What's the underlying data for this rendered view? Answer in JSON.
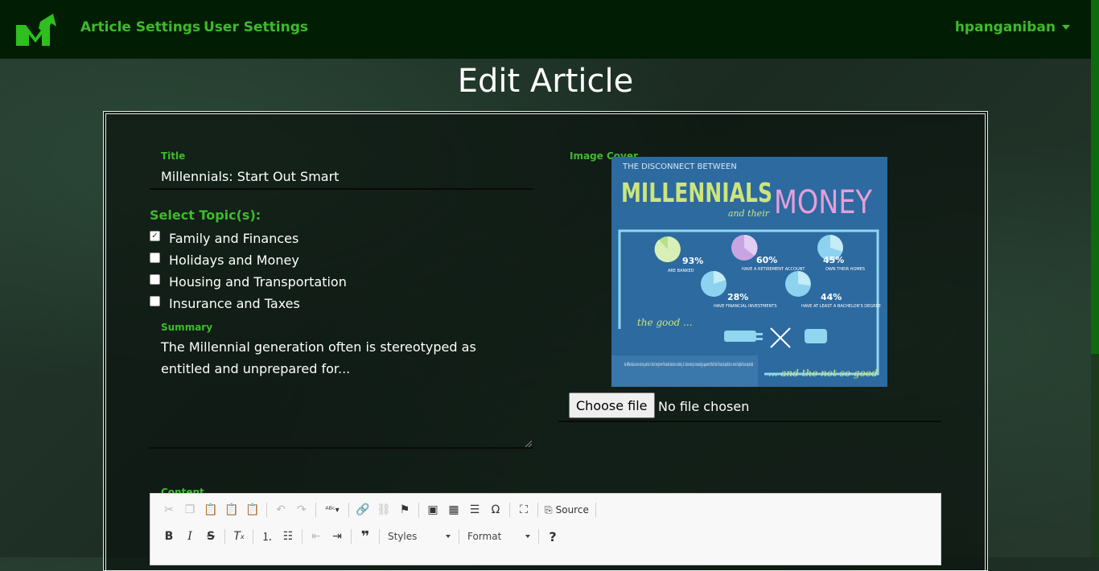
{
  "navbar": {
    "links": [
      "Article Settings",
      "User Settings"
    ],
    "username": "hpanganiban"
  },
  "page": {
    "title": "Edit Article"
  },
  "form": {
    "title_label": "Title",
    "title_value": "Millennials: Start Out Smart",
    "topics_heading": "Select Topic(s):",
    "topics": [
      {
        "label": "Family and Finances",
        "checked": true
      },
      {
        "label": "Holidays and Money",
        "checked": false
      },
      {
        "label": "Housing and Transportation",
        "checked": false
      },
      {
        "label": "Insurance and Taxes",
        "checked": false
      }
    ],
    "summary_label": "Summary",
    "summary_value": "The Millennial generation often is stereotyped as entitled and unprepared for...",
    "image_cover_label": "Image Cover",
    "file_button": "Choose file",
    "file_status": "No file chosen",
    "content_label": "Content"
  },
  "cover_image": {
    "line1": "THE DISCONNECT BETWEEN",
    "line2": "MILLENNIALS",
    "line3": "and their",
    "line4": "MONEY",
    "stats": [
      {
        "pct": "93%",
        "text": "ARE BANKED"
      },
      {
        "pct": "60%",
        "text": "HAVE A RETIREMENT ACCOUNT"
      },
      {
        "pct": "45%",
        "text": "OWN THEIR HOMES"
      },
      {
        "pct": "28%",
        "text": "HAVE FINANCIAL INVESTMENTS"
      },
      {
        "pct": "44%",
        "text": "HAVE AT LEAST A BACHELOR'S DEGREE"
      }
    ],
    "good": "the good ...",
    "bad": "... and the not so good",
    "body": "As Millennials arrive at key points in their long-term financial decision making, it is becoming increasingly apparent that their financial position is more fragile than expected"
  },
  "editor": {
    "source_label": "Source",
    "styles_label": "Styles",
    "format_label": "Format",
    "help_label": "?"
  },
  "colors": {
    "accent": "#3fba2c",
    "navbar": "#011e05",
    "cover_bg": "#2c6aa0"
  }
}
